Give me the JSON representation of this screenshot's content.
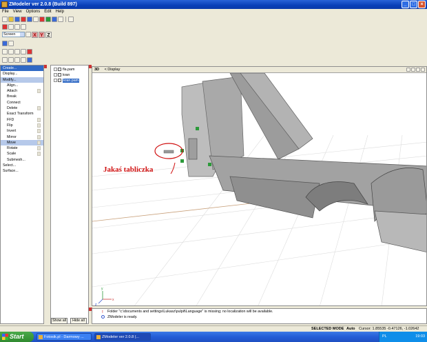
{
  "window": {
    "title": "ZModeler ver 2.0.8 (Build 897)",
    "controls": {
      "minimize": "_",
      "maximize": "□",
      "close": "×"
    }
  },
  "menu": [
    "File",
    "View",
    "Options",
    "Edit",
    "Help"
  ],
  "toolbar": {
    "view_mode": "Screen",
    "axes": [
      "X",
      "Y",
      "Z"
    ]
  },
  "command_panel": {
    "items": [
      {
        "label": "Create...",
        "style": "hl"
      },
      {
        "label": "Display...",
        "style": ""
      },
      {
        "label": "Modify...",
        "style": "sel"
      },
      {
        "label": "Align...",
        "style": "sub"
      },
      {
        "label": "Attach",
        "style": "sub",
        "arrow": true
      },
      {
        "label": "Break",
        "style": "sub"
      },
      {
        "label": "Connect",
        "style": "sub"
      },
      {
        "label": "Delete",
        "style": "sub",
        "arrow": true
      },
      {
        "label": "Exact Transform",
        "style": "sub"
      },
      {
        "label": "FFD",
        "style": "sub",
        "arrow": true
      },
      {
        "label": "Flip",
        "style": "sub",
        "arrow": true
      },
      {
        "label": "Invert",
        "style": "sub",
        "arrow": true
      },
      {
        "label": "Mirror",
        "style": "sub",
        "arrow": true
      },
      {
        "label": "Move",
        "style": "sub sel",
        "arrow": true
      },
      {
        "label": "Rotate",
        "style": "sub",
        "arrow": true
      },
      {
        "label": "Scale",
        "style": "sub",
        "arrow": true
      },
      {
        "label": "Submesh...",
        "style": "sub"
      },
      {
        "label": "Select...",
        "style": ""
      },
      {
        "label": "Surface...",
        "style": ""
      }
    ]
  },
  "hierarchy": {
    "items": [
      {
        "label": "fla.pam",
        "selected": false
      },
      {
        "label": "kran",
        "selected": false
      },
      {
        "label": "kran.pam",
        "selected": true
      }
    ],
    "show_all_label": "Show all",
    "hide_all_label": "Hide all"
  },
  "viewport": {
    "label": "3D",
    "mode_label": "< Display",
    "annotation": "Jakaś tabliczka",
    "annotation_color": "#d01010",
    "axis_labels": {
      "x": "x",
      "y": "y",
      "z": "z"
    }
  },
  "console": {
    "lines": [
      "Folder \"c:\\documents and settings\\Lukasz\\pulpit\\Language\" is missing; no localization will be available.",
      "ZModeler is ready."
    ]
  },
  "status": {
    "mode": "SELECTED MODE",
    "auto": "Auto",
    "cursor": "Cursor: 1.85535 -0.47126, -1.02642"
  },
  "taskbar": {
    "start_label": "Start",
    "tasks": [
      {
        "label": "Fotosik.pl - Darmowy ...",
        "active": false
      },
      {
        "label": "ZModeler ver 2.0.8 (...",
        "active": true
      }
    ],
    "tray": {
      "lang": "PL",
      "time": "19:03"
    }
  },
  "colors": {
    "accent": "#316ac5",
    "title_blue": "#0a3fb8",
    "start_green": "#2f8a2f"
  }
}
